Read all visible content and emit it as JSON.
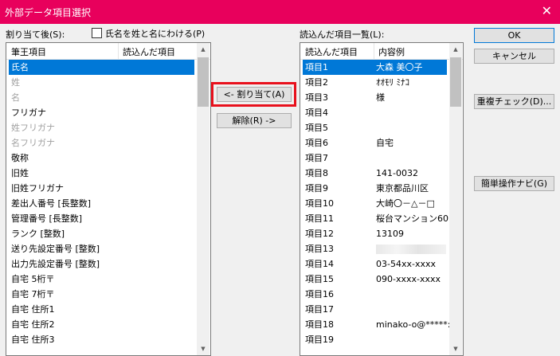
{
  "window": {
    "title": "外部データ項目選択",
    "close_glyph": "✕"
  },
  "left_panel": {
    "label": "割り当て後(S):",
    "checkbox_label": "氏名を姓と名にわける(P)",
    "columns": [
      "筆王項目",
      "読込んだ項目"
    ],
    "rows": [
      {
        "field": "氏名",
        "state": "selected"
      },
      {
        "field": "姓",
        "state": "disabled"
      },
      {
        "field": "名",
        "state": "disabled"
      },
      {
        "field": "フリガナ",
        "state": "normal"
      },
      {
        "field": "姓フリガナ",
        "state": "disabled"
      },
      {
        "field": "名フリガナ",
        "state": "disabled"
      },
      {
        "field": "敬称",
        "state": "normal"
      },
      {
        "field": "旧姓",
        "state": "normal"
      },
      {
        "field": "旧姓フリガナ",
        "state": "normal"
      },
      {
        "field": "差出人番号 [長整数]",
        "state": "normal"
      },
      {
        "field": "管理番号 [長整数]",
        "state": "normal"
      },
      {
        "field": "ランク [整数]",
        "state": "normal"
      },
      {
        "field": "送り先設定番号 [整数]",
        "state": "normal"
      },
      {
        "field": "出力先設定番号 [整数]",
        "state": "normal"
      },
      {
        "field": "自宅 5桁〒",
        "state": "normal"
      },
      {
        "field": "自宅 7桁〒",
        "state": "normal"
      },
      {
        "field": "自宅 住所1",
        "state": "normal"
      },
      {
        "field": "自宅 住所2",
        "state": "normal"
      },
      {
        "field": "自宅 住所3",
        "state": "normal"
      }
    ]
  },
  "middle_buttons": {
    "assign": "<- 割り当て(A)",
    "release": "解除(R) ->"
  },
  "right_panel": {
    "label": "読込んだ項目一覧(L):",
    "columns": [
      "読込んだ項目",
      "内容例"
    ],
    "rows": [
      {
        "item": "項目1",
        "example": "大森 美〇子",
        "state": "selected"
      },
      {
        "item": "項目2",
        "example": "ｵｵﾓﾘ ﾐﾅｺ",
        "state": "normal"
      },
      {
        "item": "項目3",
        "example": "様",
        "state": "normal"
      },
      {
        "item": "項目4",
        "example": "",
        "state": "normal"
      },
      {
        "item": "項目5",
        "example": "",
        "state": "normal"
      },
      {
        "item": "項目6",
        "example": "自宅",
        "state": "normal"
      },
      {
        "item": "項目7",
        "example": "",
        "state": "normal"
      },
      {
        "item": "項目8",
        "example": "141-0032",
        "state": "normal"
      },
      {
        "item": "項目9",
        "example": "東京都品川区",
        "state": "normal"
      },
      {
        "item": "項目10",
        "example": "大崎〇－△－□",
        "state": "normal"
      },
      {
        "item": "項目11",
        "example": "桜台マンション60",
        "state": "normal"
      },
      {
        "item": "項目12",
        "example": "13109",
        "state": "normal"
      },
      {
        "item": "項目13",
        "example": "",
        "state": "blurred"
      },
      {
        "item": "項目14",
        "example": "03-54xx-xxxx",
        "state": "normal"
      },
      {
        "item": "項目15",
        "example": "090-xxxx-xxxx",
        "state": "normal"
      },
      {
        "item": "項目16",
        "example": "",
        "state": "normal"
      },
      {
        "item": "項目17",
        "example": "",
        "state": "normal"
      },
      {
        "item": "項目18",
        "example": "minako-o@*****:",
        "state": "normal"
      },
      {
        "item": "項目19",
        "example": "",
        "state": "normal"
      }
    ]
  },
  "side_buttons": {
    "ok": "OK",
    "cancel": "キャンセル",
    "duplicate_check": "重複チェック(D)...",
    "easy_navi": "簡単操作ナビ(G)"
  },
  "colors": {
    "title_bar": "#e8005c",
    "selection": "#0078d7",
    "highlight_box": "#e8101c"
  }
}
